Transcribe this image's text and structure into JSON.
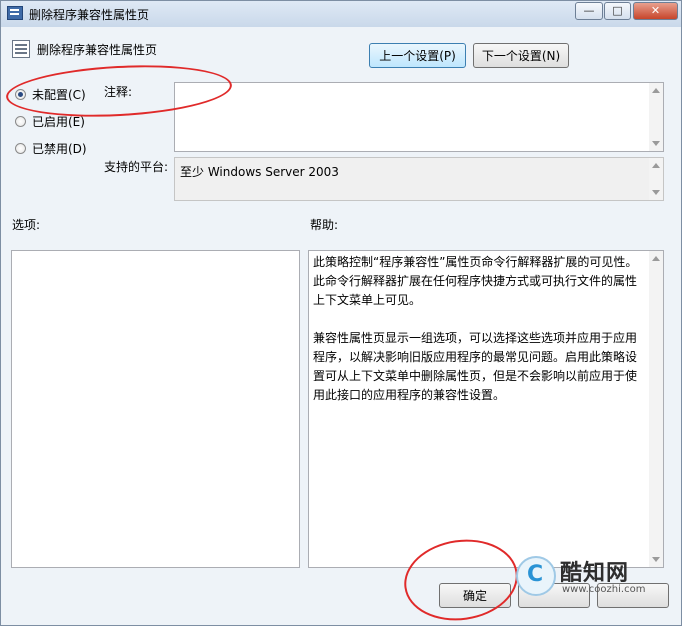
{
  "window": {
    "title": "删除程序兼容性属性页"
  },
  "header": {
    "title": "删除程序兼容性属性页",
    "prev_button": "上一个设置(P)",
    "next_button": "下一个设置(N)"
  },
  "radios": [
    {
      "label": "未配置(C)",
      "checked": true
    },
    {
      "label": "已启用(E)",
      "checked": false
    },
    {
      "label": "已禁用(D)",
      "checked": false
    }
  ],
  "comment": {
    "label": "注释:",
    "value": ""
  },
  "platform": {
    "label": "支持的平台:",
    "value": "至少 Windows Server 2003"
  },
  "options": {
    "label": "选项:"
  },
  "help": {
    "label": "帮助:",
    "paragraphs": [
      "此策略控制“程序兼容性”属性页命令行解释器扩展的可见性。此命令行解释器扩展在任何程序快捷方式或可执行文件的属性上下文菜单上可见。",
      "兼容性属性页显示一组选项，可以选择这些选项并应用于应用程序，以解决影响旧版应用程序的最常见问题。启用此策略设置可从上下文菜单中删除属性页，但是不会影响以前应用于使用此接口的应用程序的兼容性设置。"
    ]
  },
  "footer": {
    "ok_button": "确定"
  },
  "watermark": {
    "name": "酷知网",
    "url": "www.coozhi.com"
  },
  "colors": {
    "annotation": "#e02a2a",
    "accent": "#3c7fb1"
  }
}
